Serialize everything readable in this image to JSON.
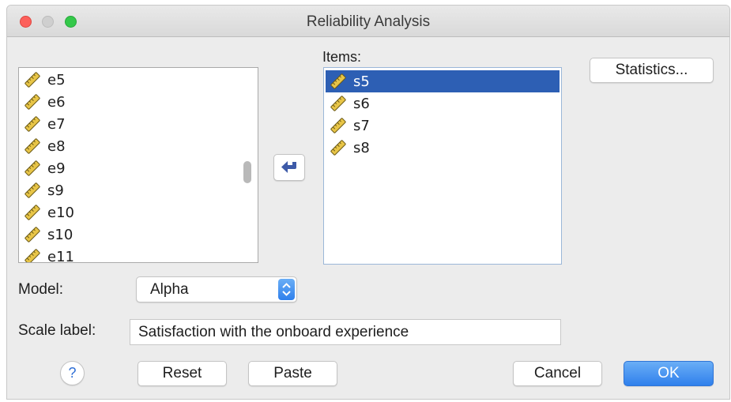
{
  "window": {
    "title": "Reliability Analysis"
  },
  "variables": {
    "items": [
      "e5",
      "e6",
      "e7",
      "e8",
      "e9",
      "s9",
      "e10",
      "s10",
      "e11"
    ]
  },
  "items_panel": {
    "label": "Items:",
    "items": [
      "s5",
      "s6",
      "s7",
      "s8"
    ],
    "selected": "s5"
  },
  "buttons": {
    "statistics": "Statistics...",
    "reset": "Reset",
    "paste": "Paste",
    "cancel": "Cancel",
    "ok": "OK",
    "help": "?"
  },
  "model": {
    "label": "Model:",
    "value": "Alpha"
  },
  "scale": {
    "label": "Scale label:",
    "value": "Satisfaction with the onboard experience"
  },
  "icons": {
    "variable": "scale-ruler-icon",
    "move": "arrow-left-icon",
    "select": "up-down-chevron-icon"
  },
  "colors": {
    "selection": "#2d5fb4",
    "accent": "#2f80ec",
    "close": "#fc605b",
    "maximize": "#34c84a"
  }
}
